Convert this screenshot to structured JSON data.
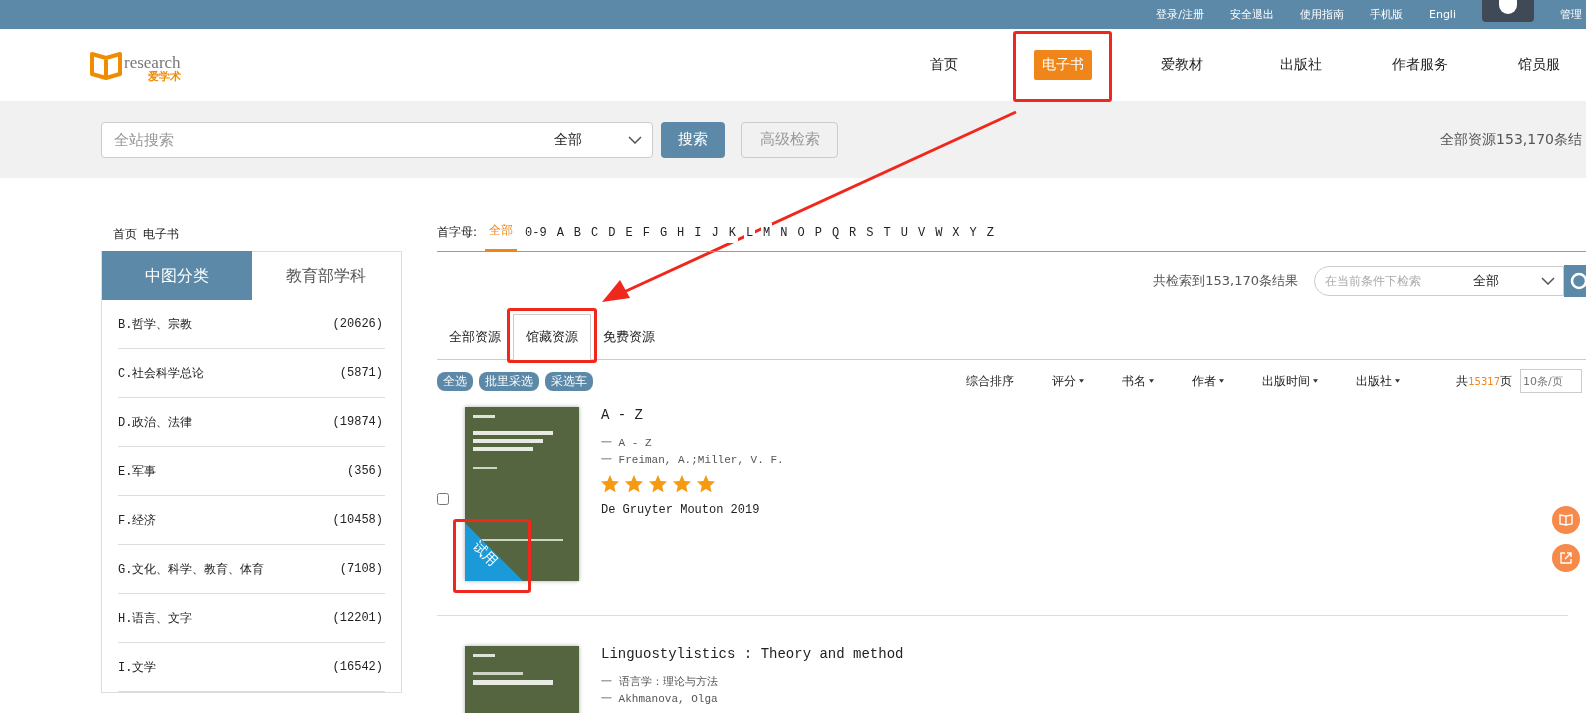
{
  "top_links": [
    "登录/注册",
    "安全退出",
    "使用指南",
    "手机版",
    "Engli",
    "管理"
  ],
  "logo": {
    "name": "research",
    "subtitle": "爱学术"
  },
  "nav": [
    {
      "label": "首页",
      "selected": false,
      "highlighted": false
    },
    {
      "label": "电子书",
      "selected": true,
      "highlighted": true
    },
    {
      "label": "爱教材",
      "selected": false,
      "highlighted": false
    },
    {
      "label": "出版社",
      "selected": false,
      "highlighted": false
    },
    {
      "label": "作者服务",
      "selected": false,
      "highlighted": false
    },
    {
      "label": "馆员服",
      "selected": false,
      "highlighted": false
    }
  ],
  "search": {
    "placeholder": "全站搜索",
    "scope": "全部",
    "button": "搜索",
    "advanced": "高级检索",
    "summary": "全部资源153,170条结"
  },
  "breadcrumb": [
    "首页",
    "电子书"
  ],
  "sidebar": {
    "tabs": [
      {
        "label": "中图分类",
        "selected": true
      },
      {
        "label": "教育部学科",
        "selected": false
      }
    ],
    "items": [
      {
        "name": "B.哲学、宗教",
        "count": "(20626)"
      },
      {
        "name": "C.社会科学总论",
        "count": "(5871)"
      },
      {
        "name": "D.政治、法律",
        "count": "(19874)"
      },
      {
        "name": "E.军事",
        "count": "(356)"
      },
      {
        "name": "F.经济",
        "count": "(10458)"
      },
      {
        "name": "G.文化、科学、教育、体育",
        "count": "(7108)"
      },
      {
        "name": "H.语言、文字",
        "count": "(12201)"
      },
      {
        "name": "I.文学",
        "count": "(16542)"
      }
    ]
  },
  "letters": {
    "label": "首字母:",
    "items": [
      {
        "label": "全部",
        "selected": true
      },
      {
        "label": "0-9",
        "selected": false
      },
      {
        "label": "A",
        "selected": false
      },
      {
        "label": "B",
        "selected": false
      },
      {
        "label": "C",
        "selected": false
      },
      {
        "label": "D",
        "selected": false
      },
      {
        "label": "E",
        "selected": false
      },
      {
        "label": "F",
        "selected": false
      },
      {
        "label": "G",
        "selected": false
      },
      {
        "label": "H",
        "selected": false
      },
      {
        "label": "I",
        "selected": false
      },
      {
        "label": "J",
        "selected": false
      },
      {
        "label": "K",
        "selected": false
      },
      {
        "label": "L",
        "selected": false
      },
      {
        "label": "M",
        "selected": false
      },
      {
        "label": "N",
        "selected": false
      },
      {
        "label": "O",
        "selected": false
      },
      {
        "label": "P",
        "selected": false
      },
      {
        "label": "Q",
        "selected": false
      },
      {
        "label": "R",
        "selected": false
      },
      {
        "label": "S",
        "selected": false
      },
      {
        "label": "T",
        "selected": false
      },
      {
        "label": "U",
        "selected": false
      },
      {
        "label": "V",
        "selected": false
      },
      {
        "label": "W",
        "selected": false
      },
      {
        "label": "X",
        "selected": false
      },
      {
        "label": "Y",
        "selected": false
      },
      {
        "label": "Z",
        "selected": false
      }
    ]
  },
  "result_count": "共检索到153,170条结果",
  "filter": {
    "placeholder": "在当前条件下检索",
    "scope": "全部"
  },
  "resource_tabs": [
    {
      "label": "全部资源",
      "selected": false,
      "highlighted": false
    },
    {
      "label": "馆藏资源",
      "selected": true,
      "highlighted": true
    },
    {
      "label": "免费资源",
      "selected": false,
      "highlighted": false
    }
  ],
  "actions": [
    "全选",
    "批里采选",
    "采选车"
  ],
  "sorts": [
    {
      "label": "综合排序",
      "caret": false
    },
    {
      "label": "评分",
      "caret": true
    },
    {
      "label": "书名",
      "caret": true
    },
    {
      "label": "作者",
      "caret": true
    },
    {
      "label": "出版时间",
      "caret": true
    },
    {
      "label": "出版社",
      "caret": true
    }
  ],
  "pages": {
    "prefix": "共",
    "count": "15317",
    "suffix": "页",
    "size_placeholder": "10条/页"
  },
  "books": [
    {
      "title": "A - Z",
      "subtitle": "一 A - Z",
      "authors": "一 Freiman, A.;Miller, V. F.",
      "stars": 5,
      "publisher": "De Gruyter Mouton 2019",
      "checked": false,
      "trial": "试用",
      "trial_highlighted": true
    },
    {
      "title": "Linguostylistics : Theory and method",
      "subtitle": "一 语言学：理论与方法",
      "authors": "一 Akhmanova, Olga"
    }
  ]
}
